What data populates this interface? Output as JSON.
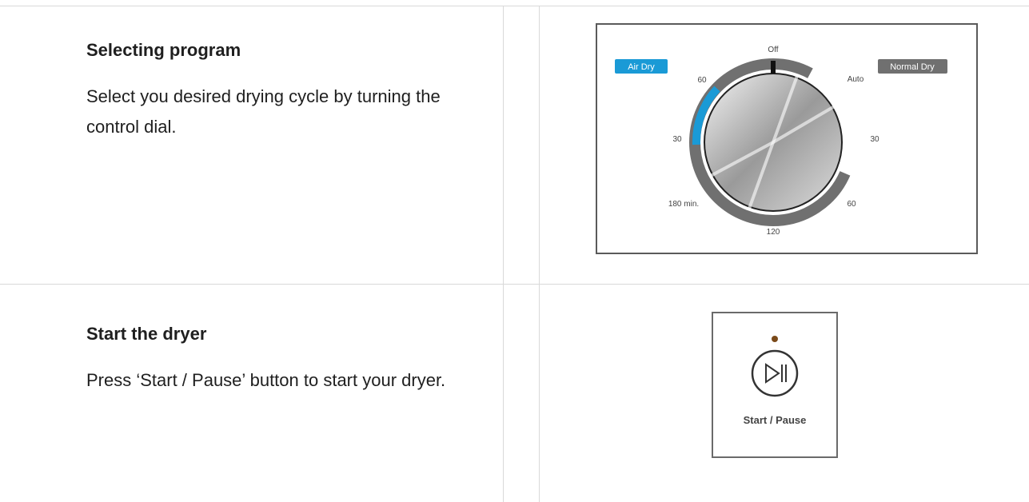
{
  "rows": [
    {
      "title": "Selecting program",
      "body": "Select you desired drying cycle by turning the control dial."
    },
    {
      "title": "Start the dryer",
      "body": "Press ‘Start / Pause’ button to start your dryer."
    }
  ],
  "dial": {
    "air_dry_label": "Air Dry",
    "normal_dry_label": "Normal Dry",
    "off_label": "Off",
    "auto_label": "Auto",
    "left_60": "60",
    "left_30": "30",
    "left_180": "180 min.",
    "bottom_120": "120",
    "right_60": "60",
    "right_30": "30",
    "colors": {
      "air": "#1a9ad6",
      "normal": "#707070"
    }
  },
  "start_pause": {
    "label": "Start / Pause",
    "icon": "play-pause-icon"
  }
}
